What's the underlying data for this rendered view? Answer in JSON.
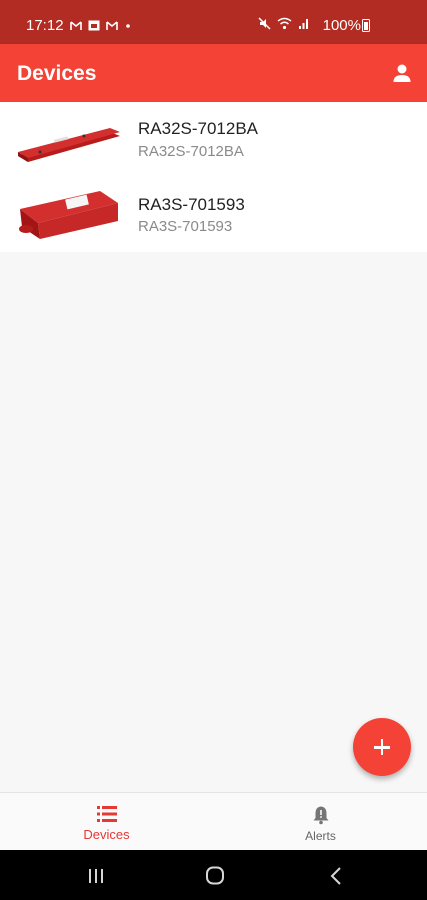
{
  "status_bar": {
    "time": "17:12",
    "battery": "100%",
    "icons": [
      "gmail-icon",
      "calendar-icon",
      "gmail-icon",
      "dot-icon",
      "mute-icon",
      "wifi-icon",
      "signal-icon",
      "battery-icon"
    ]
  },
  "app_bar": {
    "title": "Devices",
    "account_icon": "account-icon"
  },
  "devices": [
    {
      "name": "RA32S-7012BA",
      "subtitle": "RA32S-7012BA",
      "image": "long-red-sensor-device"
    },
    {
      "name": "RA3S-701593",
      "subtitle": "RA3S-701593",
      "image": "red-box-sensor-device"
    }
  ],
  "fab": {
    "icon": "plus-icon"
  },
  "bottom_nav": {
    "items": [
      {
        "label": "Devices",
        "icon": "list-icon",
        "active": true
      },
      {
        "label": "Alerts",
        "icon": "bell-icon",
        "active": false
      }
    ]
  },
  "system_nav": {
    "icons": [
      "recent-apps-icon",
      "home-icon",
      "back-icon"
    ]
  },
  "colors": {
    "status_bar": "#b32c23",
    "primary": "#f44336",
    "active_nav": "#e53935"
  }
}
